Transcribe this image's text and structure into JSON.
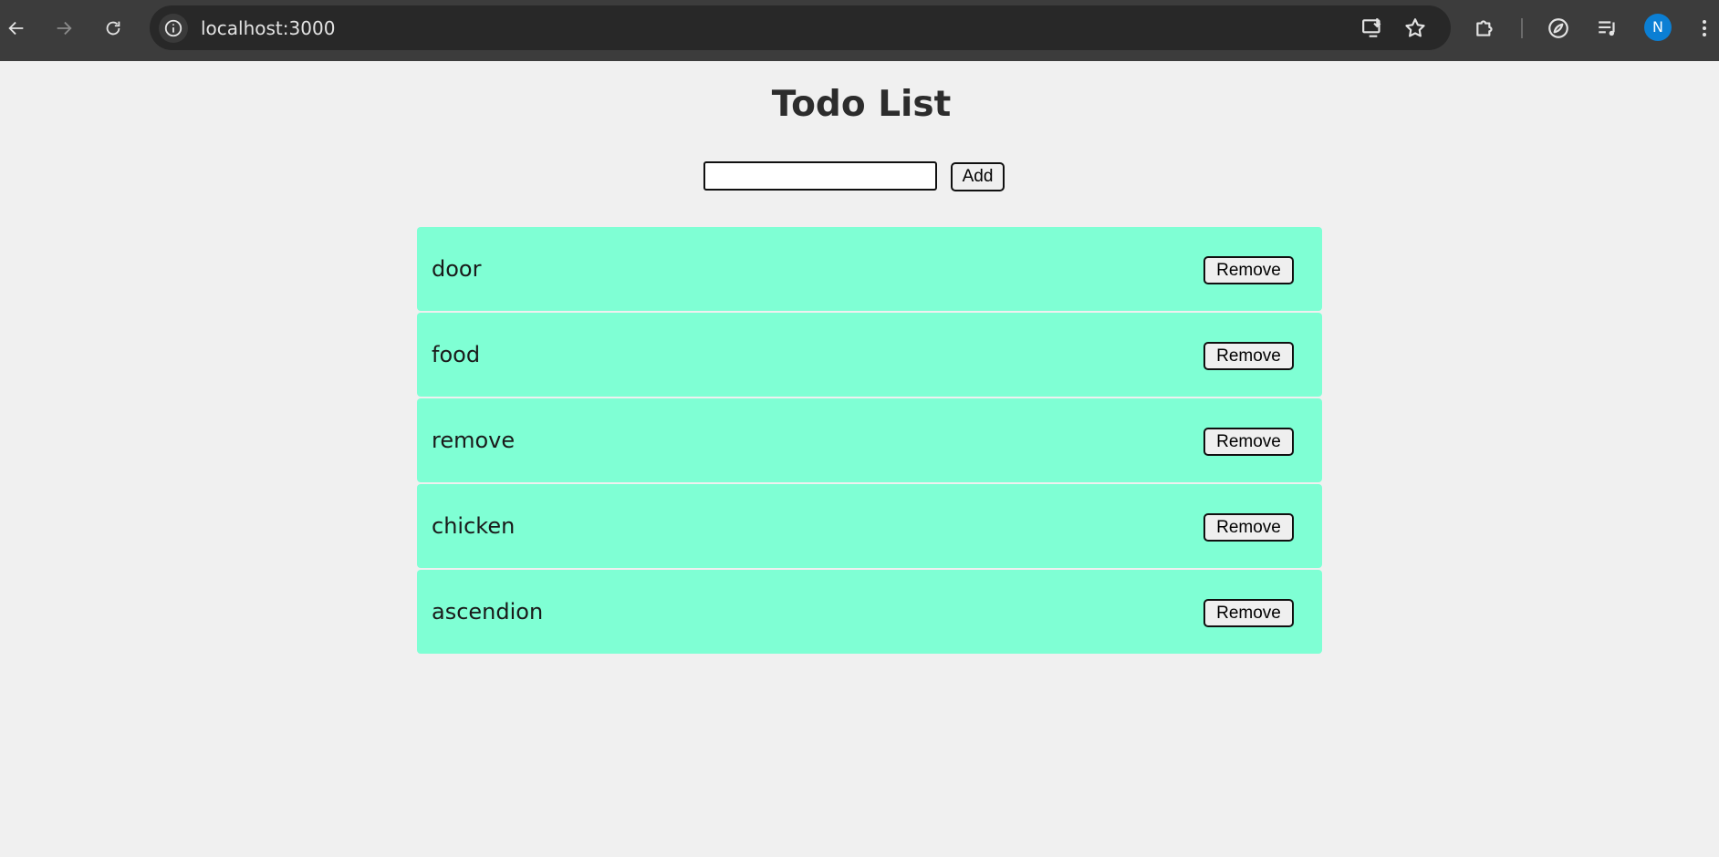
{
  "browser": {
    "url": "localhost:3000",
    "avatar_letter": "N",
    "icons": {
      "back": "arrow-left-icon",
      "forward": "arrow-right-icon",
      "reload": "reload-icon",
      "site_info": "info-icon",
      "install": "install-app-icon",
      "bookmark": "star-icon",
      "extensions": "puzzle-icon",
      "performance": "leaf-icon",
      "media": "media-playlist-icon",
      "menu": "kebab-menu-icon"
    }
  },
  "page": {
    "title": "Todo List",
    "input": {
      "value": "",
      "placeholder": ""
    },
    "add_label": "Add",
    "remove_label": "Remove",
    "items": [
      {
        "text": "door"
      },
      {
        "text": "food"
      },
      {
        "text": "remove"
      },
      {
        "text": "chicken"
      },
      {
        "text": "ascendion"
      }
    ]
  },
  "colors": {
    "page_background": "#f0f0f0",
    "item_background": "#7fffd4",
    "chrome_background": "#3c3c3c",
    "avatar": "#0b7fd4"
  }
}
